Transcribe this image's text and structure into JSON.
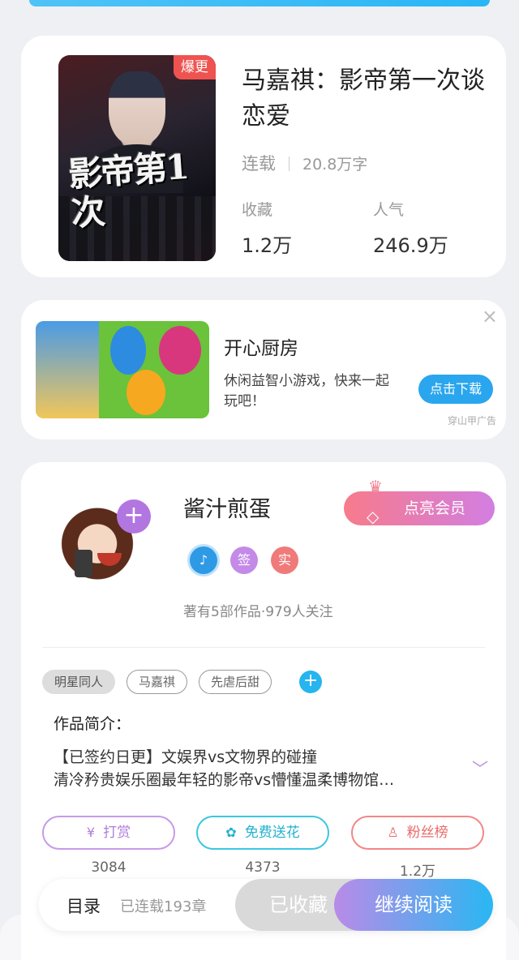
{
  "book": {
    "badge": "爆更",
    "title": "马嘉祺：影帝第一次谈恋爱",
    "cover_text": "影帝第1次",
    "status": "连载",
    "words": "20.8万字",
    "favorites_label": "收藏",
    "favorites_value": "1.2万",
    "popularity_label": "人气",
    "popularity_value": "246.9万"
  },
  "ad": {
    "close": "×",
    "title": "开心厨房",
    "desc": "休闲益智小游戏，快来一起玩吧！",
    "button": "点击下载",
    "label": "穿山甲广告"
  },
  "author": {
    "name": "酱汁煎蛋",
    "follow": "+",
    "vip_button": "点亮会员",
    "badge_sign": "签",
    "badge_real": "实",
    "meta": "著有5部作品·979人关注"
  },
  "tags": [
    "明星同人",
    "马嘉祺",
    "先虐后甜"
  ],
  "tag_add": "+",
  "intro": {
    "title": "作品简介：",
    "text": "【已签约日更】文娱界vs文物界的碰撞\n清冷矜贵娱乐圈最年轻的影帝vs懵懂温柔博物馆…"
  },
  "actions": {
    "reward_label": "打赏",
    "reward_count": "3084",
    "flower_label": "免费送花",
    "flower_count": "4373",
    "fans_label": "粉丝榜",
    "fans_count": "1.2万"
  },
  "bottom": {
    "toc": "目录",
    "chapters": "已连载193章",
    "saved": "已收藏",
    "read": "继续阅读"
  },
  "colors": {
    "accent_blue": "#29b6f6",
    "accent_purple": "#b98be8",
    "hot_red": "#ef5350"
  }
}
